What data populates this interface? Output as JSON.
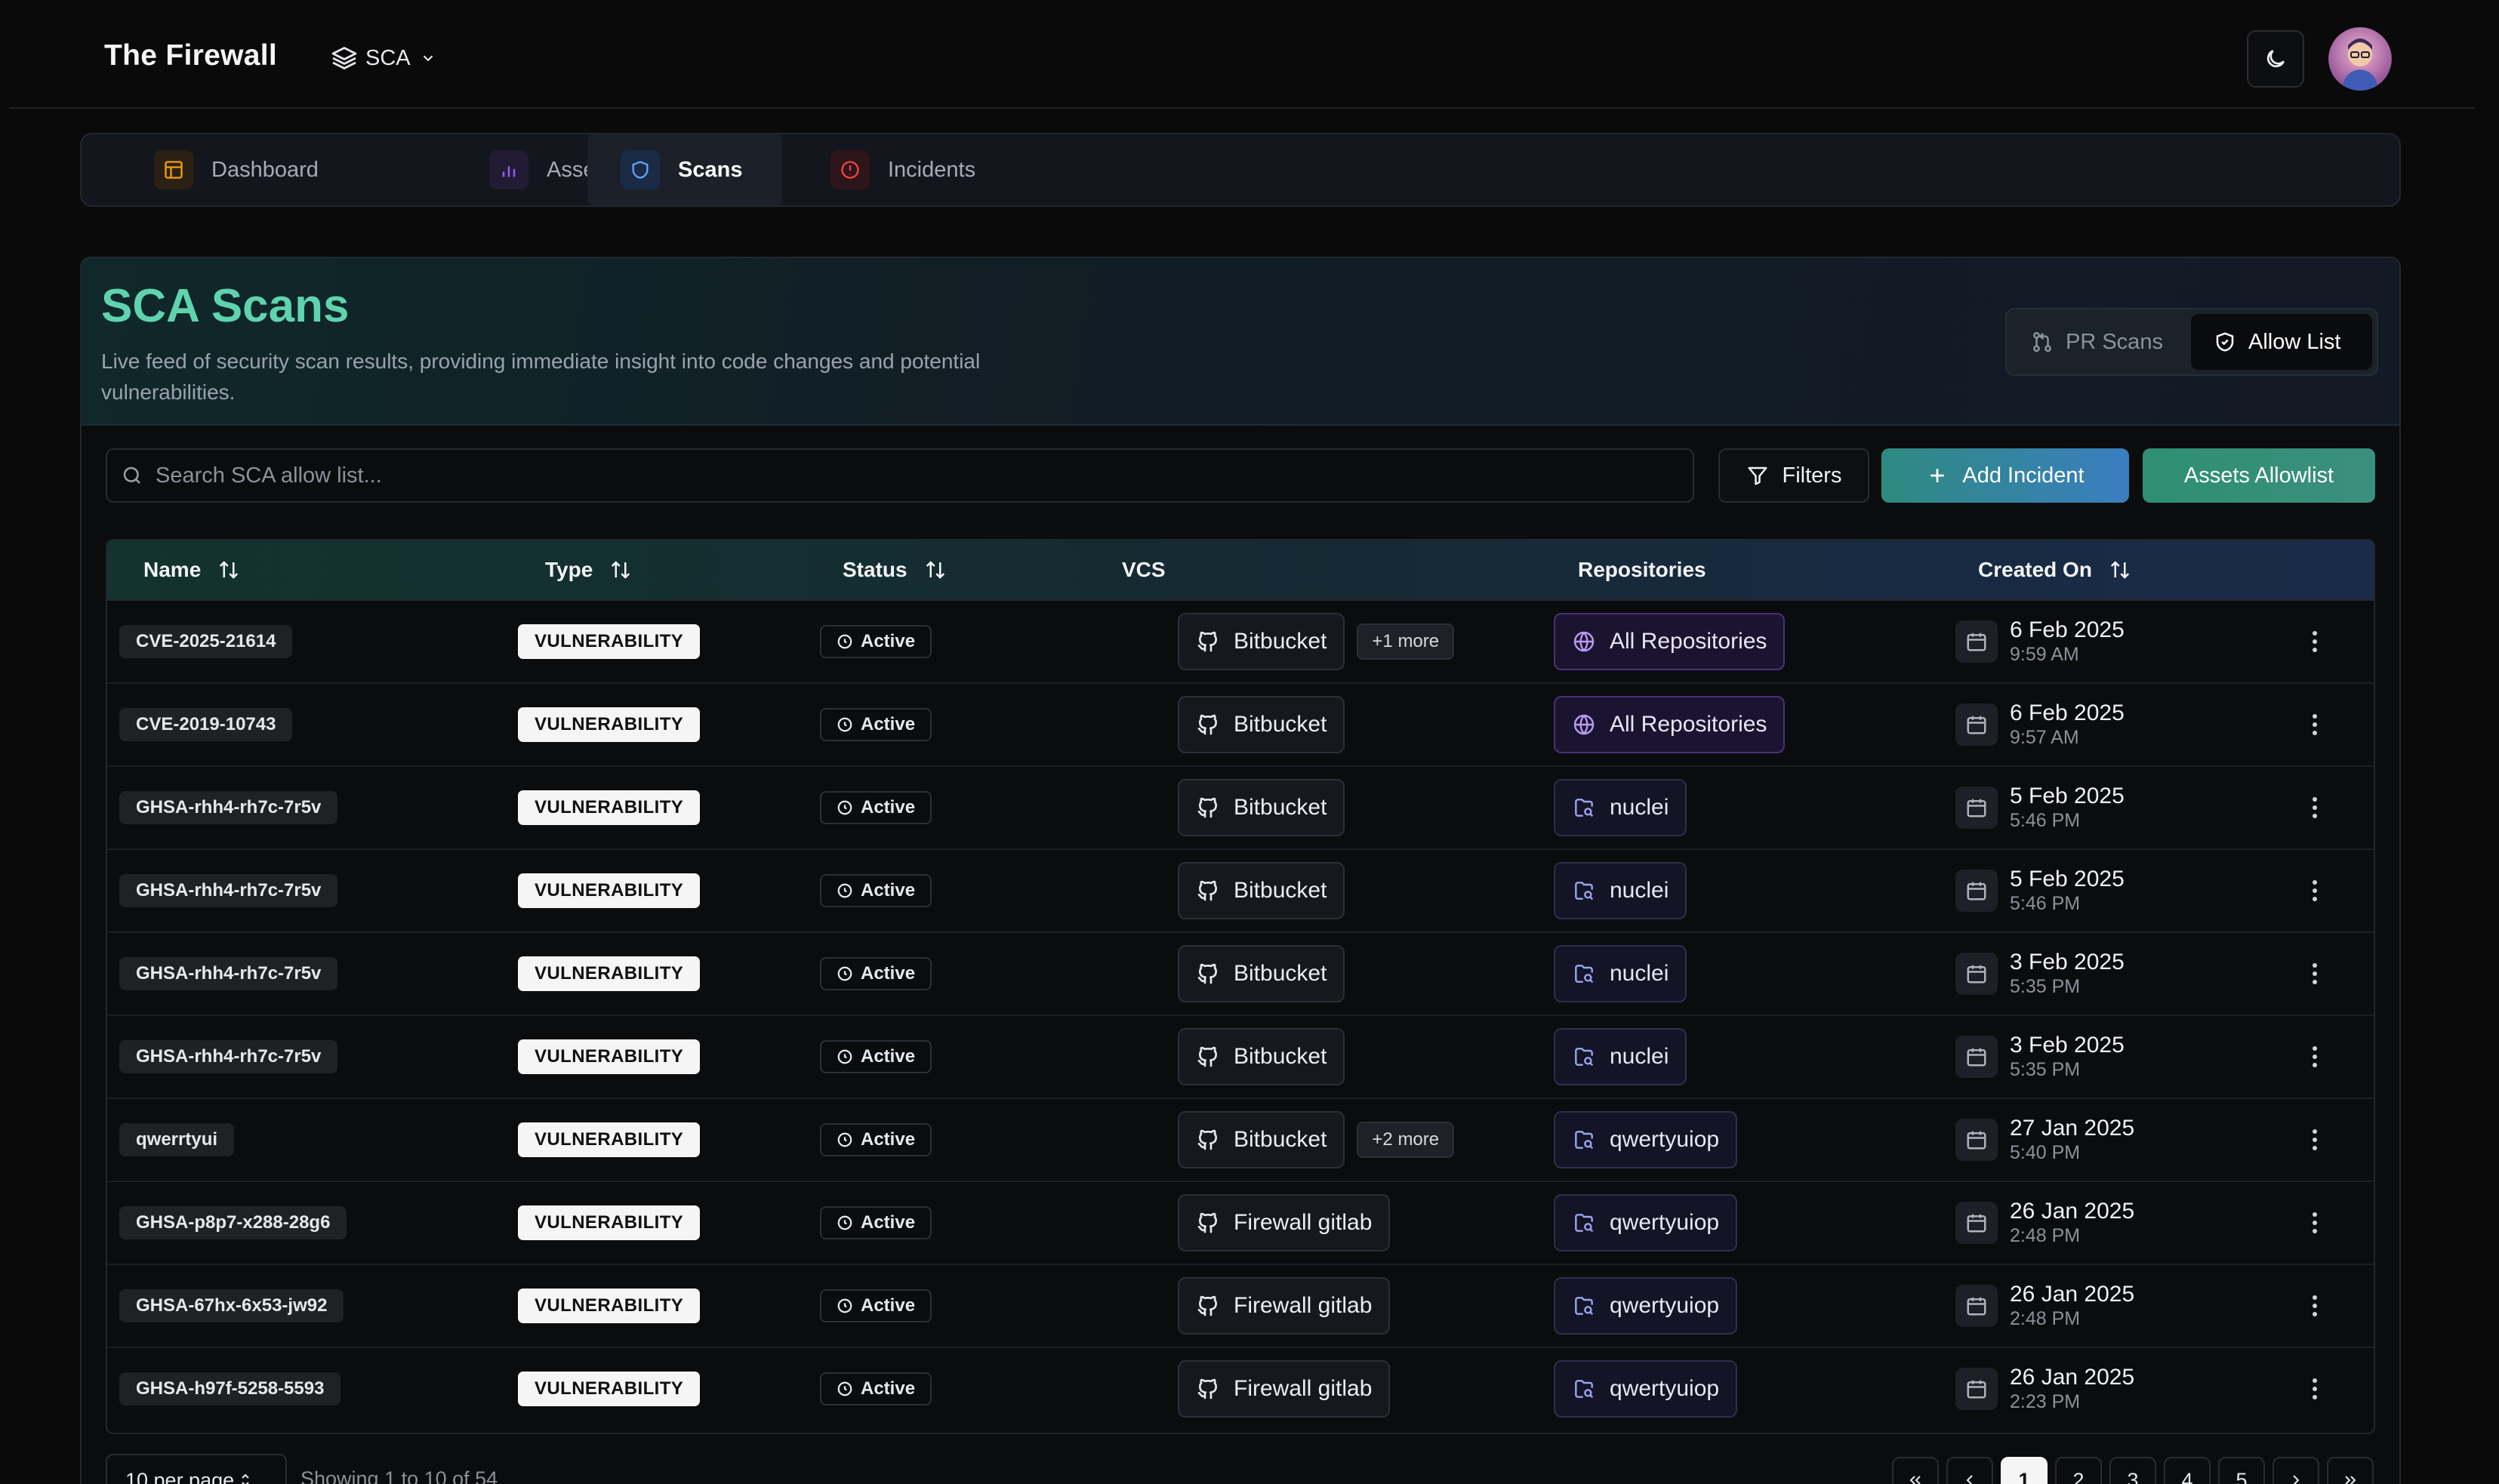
{
  "header": {
    "app_title": "The Firewall",
    "module": "SCA"
  },
  "nav": {
    "tabs": [
      {
        "label": "Dashboard",
        "icon": "layout-icon",
        "color": "#f59e0b",
        "bg": "#2a2114"
      },
      {
        "label": "Assets",
        "icon": "bar-chart-icon",
        "color": "#8b5cf6",
        "bg": "#211b33"
      },
      {
        "label": "Scans",
        "icon": "shield-icon",
        "color": "#60a5fa",
        "bg": "#1b2a45",
        "active": true
      },
      {
        "label": "Incidents",
        "icon": "alert-circle-icon",
        "color": "#ef4444",
        "bg": "#2e1519"
      }
    ]
  },
  "hero": {
    "title": "SCA Scans",
    "description": "Live feed of security scan results, providing immediate insight into code changes and potential vulnerabilities."
  },
  "segment": {
    "pr_scans": "PR Scans",
    "allow_list": "Allow List"
  },
  "toolbar": {
    "search_placeholder": "Search SCA allow list...",
    "filters": "Filters",
    "add_incident": "Add Incident",
    "assets_allowlist": "Assets Allowlist"
  },
  "table": {
    "columns": {
      "name": "Name",
      "type": "Type",
      "status": "Status",
      "vcs": "VCS",
      "repositories": "Repositories",
      "created_on": "Created On"
    },
    "rows": [
      {
        "name": "CVE-2025-21614",
        "type": "VULNERABILITY",
        "status": "Active",
        "vcs": "Bitbucket",
        "more": "+1 more",
        "repo": "All Repositories",
        "repo_kind": "all",
        "date": "6 Feb 2025",
        "time": "9:59 AM"
      },
      {
        "name": "CVE-2019-10743",
        "type": "VULNERABILITY",
        "status": "Active",
        "vcs": "Bitbucket",
        "more": "",
        "repo": "All Repositories",
        "repo_kind": "all",
        "date": "6 Feb 2025",
        "time": "9:57 AM"
      },
      {
        "name": "GHSA-rhh4-rh7c-7r5v",
        "type": "VULNERABILITY",
        "status": "Active",
        "vcs": "Bitbucket",
        "more": "",
        "repo": "nuclei",
        "repo_kind": "repo",
        "date": "5 Feb 2025",
        "time": "5:46 PM"
      },
      {
        "name": "GHSA-rhh4-rh7c-7r5v",
        "type": "VULNERABILITY",
        "status": "Active",
        "vcs": "Bitbucket",
        "more": "",
        "repo": "nuclei",
        "repo_kind": "repo",
        "date": "5 Feb 2025",
        "time": "5:46 PM"
      },
      {
        "name": "GHSA-rhh4-rh7c-7r5v",
        "type": "VULNERABILITY",
        "status": "Active",
        "vcs": "Bitbucket",
        "more": "",
        "repo": "nuclei",
        "repo_kind": "repo",
        "date": "3 Feb 2025",
        "time": "5:35 PM"
      },
      {
        "name": "GHSA-rhh4-rh7c-7r5v",
        "type": "VULNERABILITY",
        "status": "Active",
        "vcs": "Bitbucket",
        "more": "",
        "repo": "nuclei",
        "repo_kind": "repo",
        "date": "3 Feb 2025",
        "time": "5:35 PM"
      },
      {
        "name": "qwerrtyui",
        "type": "VULNERABILITY",
        "status": "Active",
        "vcs": "Bitbucket",
        "more": "+2 more",
        "repo": "qwertyuiop",
        "repo_kind": "repo",
        "date": "27 Jan 2025",
        "time": "5:40 PM"
      },
      {
        "name": "GHSA-p8p7-x288-28g6",
        "type": "VULNERABILITY",
        "status": "Active",
        "vcs": "Firewall gitlab",
        "more": "",
        "repo": "qwertyuiop",
        "repo_kind": "repo",
        "date": "26 Jan 2025",
        "time": "2:48 PM"
      },
      {
        "name": "GHSA-67hx-6x53-jw92",
        "type": "VULNERABILITY",
        "status": "Active",
        "vcs": "Firewall gitlab",
        "more": "",
        "repo": "qwertyuiop",
        "repo_kind": "repo",
        "date": "26 Jan 2025",
        "time": "2:48 PM"
      },
      {
        "name": "GHSA-h97f-5258-5593",
        "type": "VULNERABILITY",
        "status": "Active",
        "vcs": "Firewall gitlab",
        "more": "",
        "repo": "qwertyuiop",
        "repo_kind": "repo",
        "date": "26 Jan 2025",
        "time": "2:23 PM"
      }
    ]
  },
  "pagination": {
    "per_page": "10 per page",
    "showing": "Showing 1 to 10 of 54",
    "pages": [
      "1",
      "2",
      "3",
      "4",
      "5"
    ],
    "current": "1"
  }
}
